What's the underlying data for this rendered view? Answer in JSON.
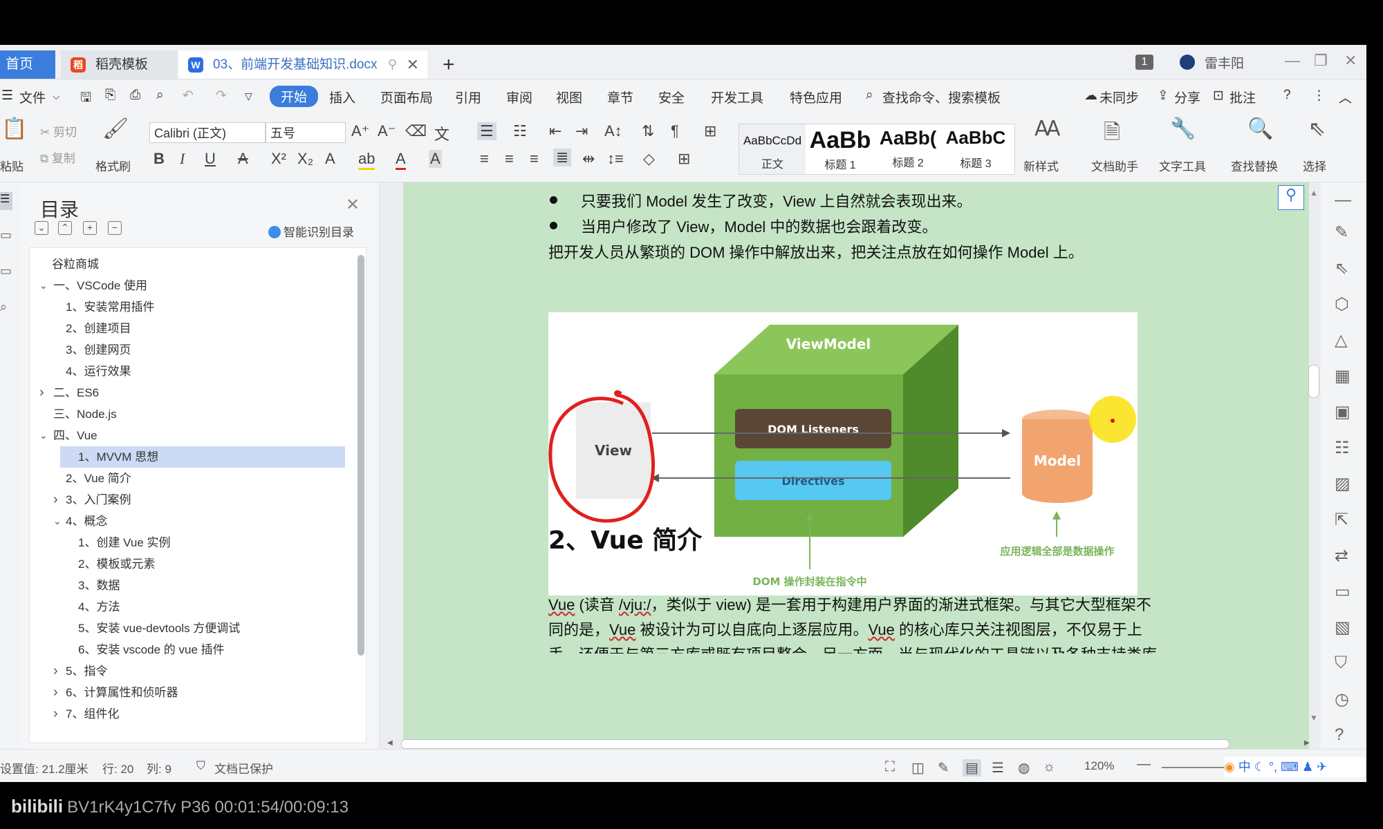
{
  "tabs": {
    "home": "首页",
    "template": "稻壳模板",
    "document": "03、前端开发基础知识.docx",
    "new_tab": "+",
    "user_badge": "1",
    "user_name": "雷丰阳"
  },
  "menu": {
    "file": "文件",
    "items": [
      "开始",
      "插入",
      "页面布局",
      "引用",
      "审阅",
      "视图",
      "章节",
      "安全",
      "开发工具",
      "特色应用"
    ],
    "active": "开始",
    "search": "查找命令、搜索模板",
    "sync": "未同步",
    "share": "分享",
    "comment": "批注",
    "help": "?"
  },
  "ribbon": {
    "paste": "粘贴",
    "cut": "剪切",
    "copy": "复制",
    "format_painter": "格式刷",
    "font_name": "Calibri (正文)",
    "font_size": "五号",
    "styles": [
      {
        "preview": "AaBbCcDd",
        "label": "正文"
      },
      {
        "preview": "AaBb",
        "label": "标题 1"
      },
      {
        "preview": "AaBb(",
        "label": "标题 2"
      },
      {
        "preview": "AaBbC",
        "label": "标题 3"
      }
    ],
    "new_style": "新样式",
    "doc_assistant": "文档助手",
    "text_tools": "文字工具",
    "find_replace": "查找替换",
    "select": "选择"
  },
  "toc": {
    "title": "目录",
    "smart_detect": "智能识别目录",
    "items": [
      {
        "text": "谷粒商城",
        "level": 0,
        "toggle": "",
        "selected": false
      },
      {
        "text": "一、VSCode 使用",
        "level": 1,
        "toggle": "open",
        "selected": false
      },
      {
        "text": "1、安装常用插件",
        "level": 2,
        "toggle": "",
        "selected": false
      },
      {
        "text": "2、创建项目",
        "level": 2,
        "toggle": "",
        "selected": false
      },
      {
        "text": "3、创建网页",
        "level": 2,
        "toggle": "",
        "selected": false
      },
      {
        "text": "4、运行效果",
        "level": 2,
        "toggle": "",
        "selected": false
      },
      {
        "text": "二、ES6",
        "level": 1,
        "toggle": "closed",
        "selected": false
      },
      {
        "text": "三、Node.js",
        "level": 1,
        "toggle": "",
        "selected": false
      },
      {
        "text": "四、Vue",
        "level": 1,
        "toggle": "open",
        "selected": false
      },
      {
        "text": "1、MVVM 思想",
        "level": 2,
        "toggle": "",
        "selected": true
      },
      {
        "text": "2、Vue 简介",
        "level": 2,
        "toggle": "",
        "selected": false
      },
      {
        "text": "3、入门案例",
        "level": 2,
        "toggle": "closed",
        "selected": false
      },
      {
        "text": "4、概念",
        "level": 2,
        "toggle": "open",
        "selected": false
      },
      {
        "text": "1、创建 Vue 实例",
        "level": 3,
        "toggle": "",
        "selected": false
      },
      {
        "text": "2、模板或元素",
        "level": 3,
        "toggle": "",
        "selected": false
      },
      {
        "text": "3、数据",
        "level": 3,
        "toggle": "",
        "selected": false
      },
      {
        "text": "4、方法",
        "level": 3,
        "toggle": "",
        "selected": false
      },
      {
        "text": "5、安装 vue-devtools 方便调试",
        "level": 3,
        "toggle": "",
        "selected": false
      },
      {
        "text": "6、安装 vscode 的 vue 插件",
        "level": 3,
        "toggle": "",
        "selected": false
      },
      {
        "text": "5、指令",
        "level": 2,
        "toggle": "closed",
        "selected": false
      },
      {
        "text": "6、计算属性和侦听器",
        "level": 2,
        "toggle": "closed",
        "selected": false
      },
      {
        "text": "7、组件化",
        "level": 2,
        "toggle": "closed",
        "selected": false
      }
    ]
  },
  "document": {
    "bullet1": "只要我们 Model 发生了改变，View 上自然就会表现出来。",
    "bullet2": "当用户修改了 View，Model 中的数据也会跟着改变。",
    "para1": "把开发人员从繁琐的 DOM 操作中解放出来，把关注点放在如何操作 Model 上。",
    "heading": "2、Vue 简介",
    "intro_line1": [
      "Vue",
      " (读音 ",
      "/vju:/",
      "，类似于 view) 是一套用于构建用户界面的渐进式框架。与其它大型框架不"
    ],
    "intro_line2": [
      "同的是，",
      "Vue",
      " 被设计为可以自底向上逐层应用。",
      "Vue",
      " 的核心库只关注视图层，不仅易于上"
    ],
    "intro_line3": "手，还便于与第三方库或既有项目整合。另一方面，当与现代化的工具链以及各种支持类库"
  },
  "diagram": {
    "viewmodel": "ViewModel",
    "view": "View",
    "dom_listeners": "DOM Listeners",
    "directives": "Directives",
    "model": "Model",
    "caption_left": "DOM 操作封装在指令中",
    "caption_right": "应用逻辑全部是数据操作",
    "colors": {
      "cube_front": "#72b043",
      "cube_top": "#8cc65a",
      "cube_side": "#4f8a2b",
      "listeners": "#5b4636",
      "directives": "#57c8f2",
      "model": "#f2a46e",
      "annotation": "#e02020",
      "cursor": "#f9e31a"
    }
  },
  "status": {
    "position": "设置值: 21.2厘米",
    "row": "行: 20",
    "col": "列: 9",
    "protected": "文档已保护",
    "zoom": "120%"
  },
  "overlay": {
    "logo": "bilibili",
    "video": "BV1rK4y1C7fv P36 00:01:54/00:09:13"
  }
}
